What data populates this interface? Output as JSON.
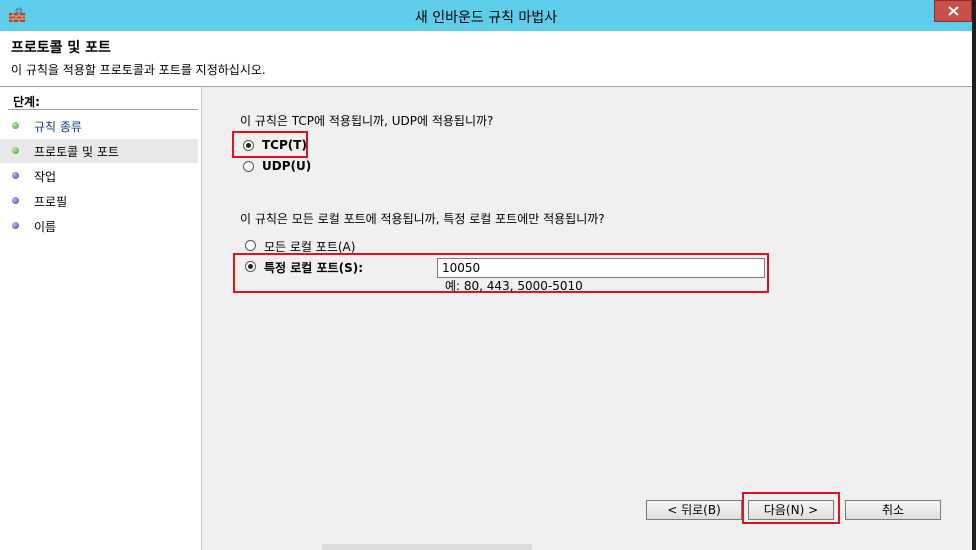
{
  "window": {
    "title": "새 인바운드 규칙 마법사"
  },
  "header": {
    "title": "프로토콜 및 포트",
    "description": "이 규칙을 적용할 프로토콜과 포트를 지정하십시오."
  },
  "steps": {
    "label": "단계:",
    "items": [
      {
        "label": "규칙 종류",
        "state": "done"
      },
      {
        "label": "프로토콜 및 포트",
        "state": "current"
      },
      {
        "label": "작업",
        "state": "todo"
      },
      {
        "label": "프로필",
        "state": "todo"
      },
      {
        "label": "이름",
        "state": "todo"
      }
    ]
  },
  "protocol": {
    "question": "이 규칙은 TCP에 적용됩니까, UDP에 적용됩니까?",
    "tcp_label": "TCP(T)",
    "udp_label": "UDP(U)",
    "selected": "TCP(T)"
  },
  "ports": {
    "question": "이 규칙은 모든 로컬 포트에 적용됩니까, 특정 로컬 포트에만 적용됩니까?",
    "all_label": "모든 로컬 포트(A)",
    "specific_label": "특정 로컬 포트(S):",
    "selected": "특정 로컬 포트(S):",
    "value": "10050",
    "hint": "예: 80, 443, 5000-5010"
  },
  "buttons": {
    "back": "< 뒤로(B)",
    "next": "다음(N) >",
    "cancel": "취소"
  },
  "colors": {
    "titlebar": "#5ecde9",
    "highlight": "#e0141e",
    "close": "#c7504a"
  }
}
